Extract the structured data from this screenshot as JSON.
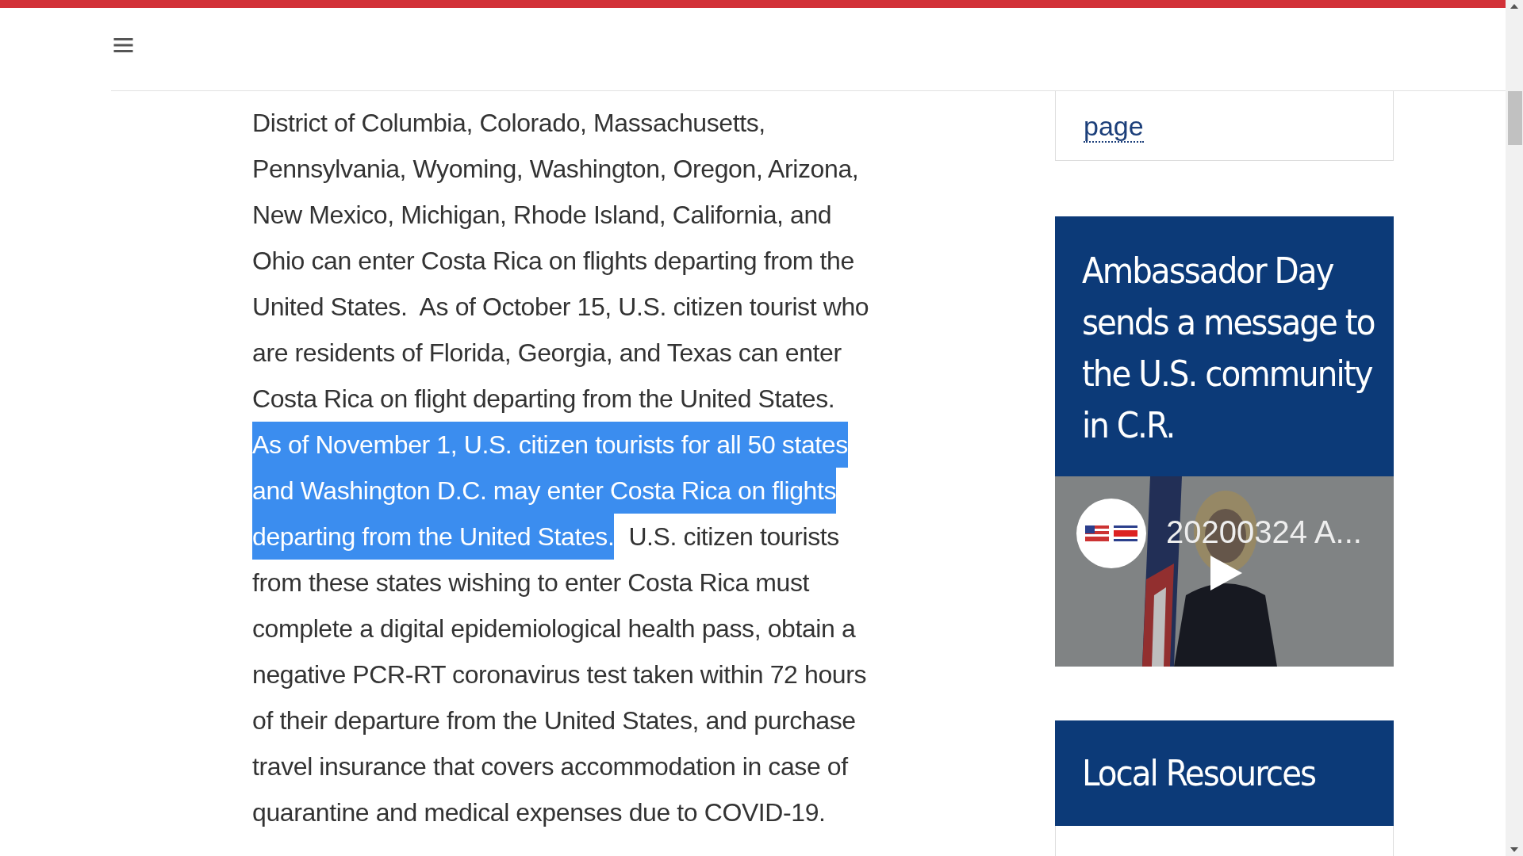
{
  "article": {
    "lines": [
      {
        "segments": [
          {
            "text": "District of Columbia, Colorado, Massachusetts,",
            "selected": false
          }
        ]
      },
      {
        "segments": [
          {
            "text": "Pennsylvania, Wyoming, Washington, Oregon, Arizona,",
            "selected": false
          }
        ]
      },
      {
        "segments": [
          {
            "text": "New Mexico, Michigan, Rhode Island, California, and",
            "selected": false
          }
        ]
      },
      {
        "segments": [
          {
            "text": "Ohio can enter Costa Rica on flights departing from the",
            "selected": false
          }
        ]
      },
      {
        "segments": [
          {
            "text": "United States.  As of October 15, U.S. citizen tourist who",
            "selected": false
          }
        ]
      },
      {
        "segments": [
          {
            "text": "are residents of Florida, Georgia, and Texas can enter",
            "selected": false
          }
        ]
      },
      {
        "segments": [
          {
            "text": "Costa Rica on flight departing from the United States.",
            "selected": false
          }
        ]
      },
      {
        "segments": [
          {
            "text": "As of November 1, U.S. citizen tourists for all 50 states",
            "selected": true
          }
        ]
      },
      {
        "segments": [
          {
            "text": "and Washington D.C. may enter Costa Rica on flights",
            "selected": true
          }
        ]
      },
      {
        "segments": [
          {
            "text": "departing from the United States.",
            "selected": true
          },
          {
            "text": "U.S. citizen tourists",
            "selected": false
          }
        ]
      },
      {
        "segments": [
          {
            "text": "from these states wishing to enter Costa Rica must",
            "selected": false
          }
        ]
      },
      {
        "segments": [
          {
            "text": "complete a digital epidemiological health pass, obtain a",
            "selected": false
          }
        ]
      },
      {
        "segments": [
          {
            "text": "negative PCR-RT coronavirus test taken within 72 hours",
            "selected": false
          }
        ]
      },
      {
        "segments": [
          {
            "text": "of their departure from the United States, and purchase",
            "selected": false
          }
        ]
      },
      {
        "segments": [
          {
            "text": "travel insurance that covers accommodation in case of",
            "selected": false
          }
        ]
      },
      {
        "segments": [
          {
            "text": "quarantine and medical expenses due to COVID-19.",
            "selected": false
          }
        ]
      }
    ]
  },
  "sidebar": {
    "advisory_link": "page",
    "video_card": {
      "title": "Ambassador Day sends a message to the U.S. community in C.R.",
      "video": {
        "title": "20200324 A..."
      }
    },
    "resources_card": {
      "title": "Local Resources"
    }
  }
}
